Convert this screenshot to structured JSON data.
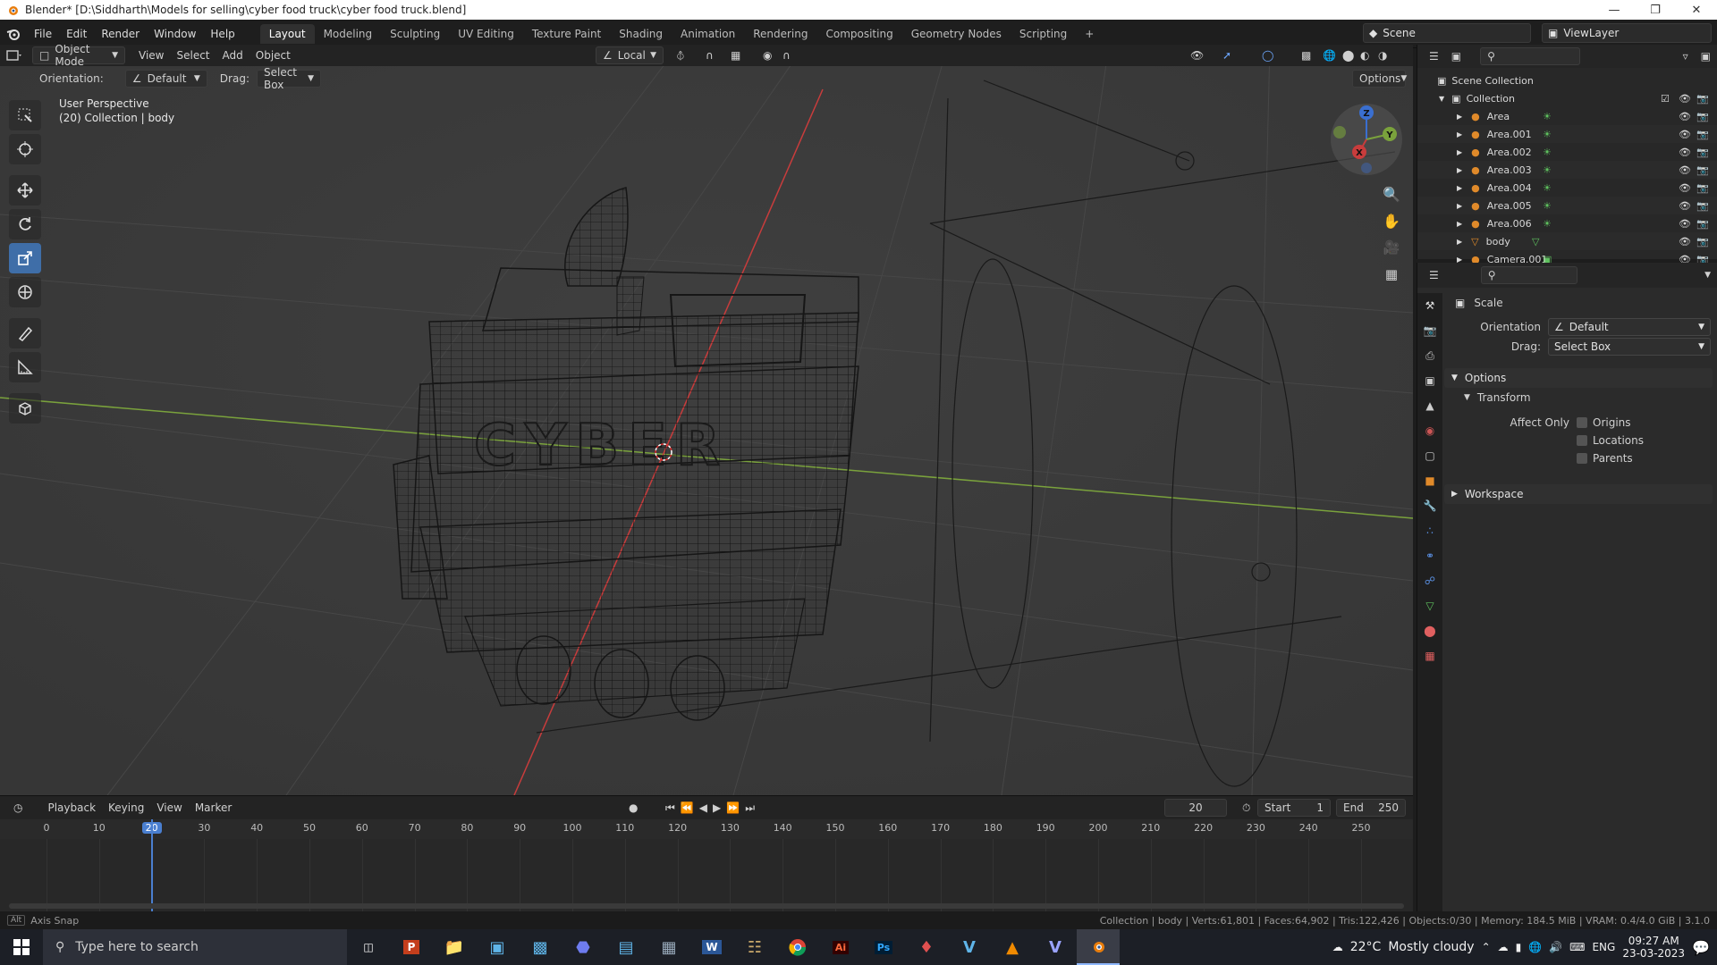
{
  "window": {
    "title": "Blender* [D:\\Siddharth\\Models for selling\\cyber food truck\\cyber food truck.blend]",
    "controls": [
      "minimize",
      "maximize",
      "close"
    ]
  },
  "menu": {
    "items": [
      "File",
      "Edit",
      "Render",
      "Window",
      "Help"
    ],
    "workspaces": [
      "Layout",
      "Modeling",
      "Sculpting",
      "UV Editing",
      "Texture Paint",
      "Shading",
      "Animation",
      "Rendering",
      "Compositing",
      "Geometry Nodes",
      "Scripting"
    ],
    "active_workspace": "Layout",
    "add_tab": "+",
    "scene": "Scene",
    "view_layer": "ViewLayer"
  },
  "viewport_header": {
    "mode": "Object Mode",
    "menus": [
      "View",
      "Select",
      "Add",
      "Object"
    ],
    "transform_orientation": "Local",
    "options": "Options"
  },
  "tool_settings": {
    "orientation_label": "Orientation:",
    "orientation_value": "Default",
    "drag_label": "Drag:",
    "drag_value": "Select Box"
  },
  "viewport": {
    "perspective": "User Perspective",
    "context": "(20) Collection | body",
    "text_on_model": "CYBER",
    "gizmo": {
      "z": "Z",
      "y": "Y",
      "x": "X"
    }
  },
  "toolbar_icons": [
    "select-box-icon",
    "cursor-icon",
    "move-icon",
    "rotate-icon",
    "scale-icon",
    "transform-icon",
    "annotate-icon",
    "measure-icon",
    "add-cube-icon"
  ],
  "outliner": {
    "root": "Scene Collection",
    "collection": "Collection",
    "items": [
      {
        "name": "Area",
        "type": "light"
      },
      {
        "name": "Area.001",
        "type": "light"
      },
      {
        "name": "Area.002",
        "type": "light"
      },
      {
        "name": "Area.003",
        "type": "light"
      },
      {
        "name": "Area.004",
        "type": "light"
      },
      {
        "name": "Area.005",
        "type": "light"
      },
      {
        "name": "Area.006",
        "type": "light"
      },
      {
        "name": "body",
        "type": "mesh"
      },
      {
        "name": "Camera.001",
        "type": "camera"
      }
    ]
  },
  "properties": {
    "tool_name": "Scale",
    "orientation_label": "Orientation",
    "orientation_value": "Default",
    "drag_label": "Drag:",
    "drag_value": "Select Box",
    "options_panel": "Options",
    "transform_panel": "Transform",
    "affect_only_label": "Affect Only",
    "affect_only": [
      "Origins",
      "Locations",
      "Parents"
    ],
    "workspace_panel": "Workspace"
  },
  "timeline": {
    "menus": [
      "Playback",
      "Keying",
      "View",
      "Marker"
    ],
    "current_frame": "20",
    "start_label": "Start",
    "start": "1",
    "end_label": "End",
    "end": "250",
    "ticks": [
      "0",
      "10",
      "20",
      "30",
      "40",
      "50",
      "60",
      "70",
      "80",
      "90",
      "100",
      "110",
      "120",
      "130",
      "140",
      "150",
      "160",
      "170",
      "180",
      "190",
      "200",
      "210",
      "220",
      "230",
      "240",
      "250"
    ]
  },
  "statusbar": {
    "left": "Axis Snap",
    "right": "Collection | body | Verts:61,801 | Faces:64,902 | Tris:122,426 | Objects:0/30 | Memory: 184.5 MiB | VRAM: 0.4/4.0 GiB | 3.1.0"
  },
  "taskbar": {
    "search_placeholder": "Type here to search",
    "weather_temp": "22°C",
    "weather_desc": "Mostly cloudy",
    "lang": "ENG",
    "time": "09:27 AM",
    "date": "23-03-2023"
  },
  "colors": {
    "accent": "#3f6ea8",
    "x_axis": "#c83c3c",
    "y_axis": "#7aa23c",
    "z_axis": "#3a6fd0"
  }
}
